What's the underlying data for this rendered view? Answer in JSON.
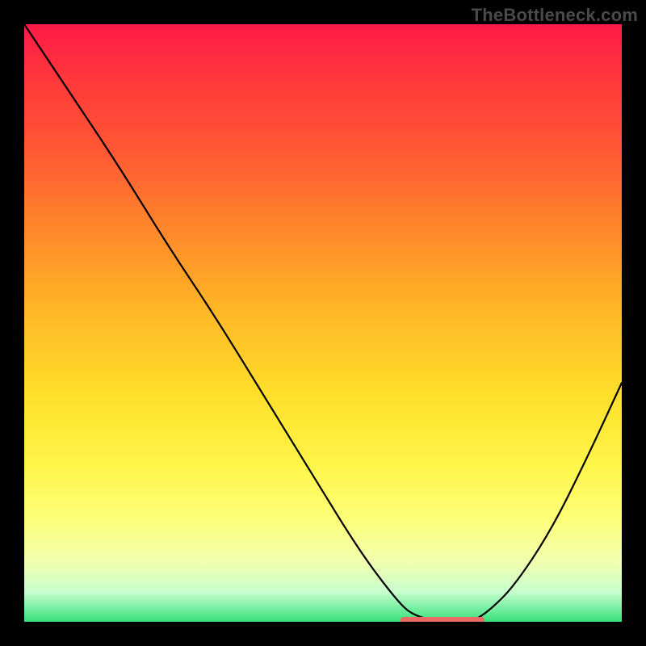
{
  "watermark": "TheBottleneck.com",
  "chart_data": {
    "type": "line",
    "title": "",
    "xlabel": "",
    "ylabel": "",
    "xlim": [
      0,
      100
    ],
    "ylim": [
      0,
      100
    ],
    "series": [
      {
        "name": "bottleneck-curve",
        "x": [
          0,
          8,
          16,
          24,
          32,
          40,
          48,
          56,
          62,
          65,
          70,
          75,
          78,
          82,
          88,
          94,
          100
        ],
        "values": [
          100,
          88,
          76,
          63,
          51,
          38,
          25,
          12,
          4,
          1,
          0,
          0,
          2,
          6,
          15,
          27,
          40
        ]
      }
    ],
    "flat_region": {
      "x_start": 63,
      "x_end": 77,
      "y": 0
    },
    "gradient_stops": [
      {
        "pos": 0,
        "color": "#ff1a48"
      },
      {
        "pos": 10,
        "color": "#ff3a3a"
      },
      {
        "pos": 22,
        "color": "#ff5a33"
      },
      {
        "pos": 35,
        "color": "#ff8a2a"
      },
      {
        "pos": 48,
        "color": "#ffb726"
      },
      {
        "pos": 62,
        "color": "#ffdf2a"
      },
      {
        "pos": 74,
        "color": "#fff64a"
      },
      {
        "pos": 83,
        "color": "#fdff7a"
      },
      {
        "pos": 90,
        "color": "#f1ffb0"
      },
      {
        "pos": 95,
        "color": "#c8ffce"
      },
      {
        "pos": 100,
        "color": "#35e07a"
      }
    ]
  }
}
